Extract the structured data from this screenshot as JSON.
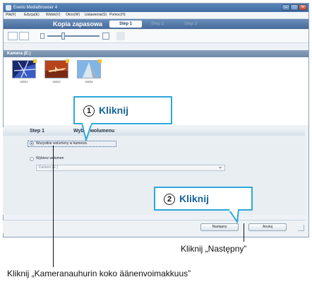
{
  "window": {
    "title": "Everio MediaBrowser 4",
    "menus": [
      "Plik(F)",
      "Edycja(E)",
      "Widok(V)",
      "Okno(W)",
      "Ustawienia(S)",
      "Pomoc(H)"
    ]
  },
  "header": {
    "mode_title": "Kopia zapasowa",
    "steps": [
      "Step 1",
      "Step 2",
      "Step 3"
    ]
  },
  "camera": {
    "title": "Kamera (E:)",
    "thumbnails": [
      "00001",
      "00002",
      "00004"
    ]
  },
  "step_section": {
    "step_label": "Step 1",
    "title": "Wybór wolumenu"
  },
  "options": {
    "all_volumes": "Wszystkie wolumeny w kamerze.",
    "select_volume": "Wybierz wolumen",
    "volume_value": "Kamera (E:)"
  },
  "buttons": {
    "next": "Następny",
    "cancel": "Anuluj"
  },
  "callouts": [
    {
      "number": "1",
      "text": "Kliknij"
    },
    {
      "number": "2",
      "text": "Kliknij"
    }
  ],
  "captions": {
    "next": "Kliknij „Następny”",
    "all_volumes": "Kliknij „Kameranauhurin koko äänenvoimakkuus”"
  },
  "colors": {
    "callout_border": "#2da8d8",
    "callout_text": "#16649b",
    "header_blue": "#46699a"
  }
}
